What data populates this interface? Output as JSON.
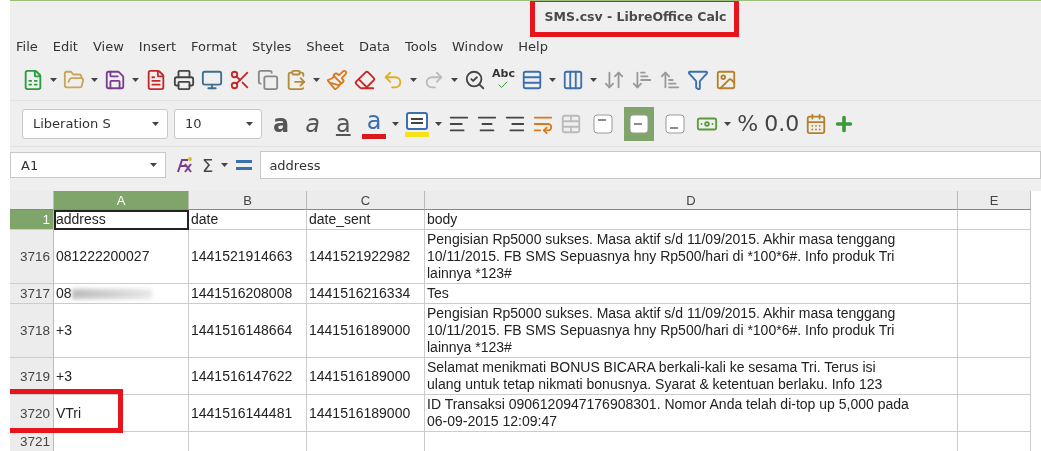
{
  "window": {
    "title": "SMS.csv - LibreOffice Calc",
    "title_highlighted": true
  },
  "menu": [
    "File",
    "Edit",
    "View",
    "Insert",
    "Format",
    "Styles",
    "Sheet",
    "Data",
    "Tools",
    "Window",
    "Help"
  ],
  "standard_toolbar": {
    "spelling_label": "Abc"
  },
  "format_toolbar": {
    "font_name": "Liberation S",
    "font_size": "10",
    "style_buttons": [
      {
        "kind": "bold",
        "label": "a"
      },
      {
        "kind": "italic",
        "label": "a"
      },
      {
        "kind": "underline",
        "label": "a"
      },
      {
        "kind": "font_color",
        "label": "a"
      }
    ],
    "vertical_align": [
      {
        "selected": false
      },
      {
        "selected": true
      },
      {
        "selected": false
      }
    ],
    "percent": "%",
    "number_format": "0.0"
  },
  "formula_bar": {
    "cell_ref": "A1",
    "sum": "Σ",
    "value": "address"
  },
  "columns": [
    {
      "label": "A",
      "selected": true
    },
    {
      "label": "B",
      "selected": false
    },
    {
      "label": "C",
      "selected": false
    },
    {
      "label": "D",
      "selected": false
    },
    {
      "label": "E",
      "selected": false
    }
  ],
  "rows": [
    {
      "number": "1",
      "selected": true,
      "highlighted": false,
      "address": "address",
      "redacted": false,
      "date": "date",
      "date_sent": "date_sent",
      "body": [
        "body"
      ]
    },
    {
      "number": "3716",
      "selected": false,
      "highlighted": false,
      "address": "081222200027",
      "redacted": false,
      "date": "1441521914663",
      "date_sent": "1441521922982",
      "body": [
        "Pengisian Rp5000 sukses. Masa aktif s/d 11/09/2015. Akhir masa tenggang",
        "10/11/2015. FB SMS Sepuasnya hny Rp500/hari di *100*6#. Info produk Tri",
        "lainnya *123#"
      ]
    },
    {
      "number": "3717",
      "selected": false,
      "highlighted": false,
      "address": "08",
      "redacted": true,
      "date": "1441516208008",
      "date_sent": "1441516216334",
      "body": [
        "Tes"
      ]
    },
    {
      "number": "3718",
      "selected": false,
      "highlighted": false,
      "address": "+3",
      "redacted": false,
      "date": "1441516148664",
      "date_sent": "1441516189000",
      "body": [
        "Pengisian Rp5000 sukses. Masa aktif s/d 11/09/2015. Akhir masa tenggang",
        "10/11/2015. FB SMS Sepuasnya hny Rp500/hari di *100*6#. Info produk Tri",
        "lainnya *123#"
      ]
    },
    {
      "number": "3719",
      "selected": false,
      "highlighted": false,
      "address": "+3",
      "redacted": false,
      "date": "1441516147622",
      "date_sent": "1441516189000",
      "body": [
        "Selamat menikmati BONUS BICARA berkali-kali ke sesama Tri. Terus isi",
        "ulang untuk tetap nikmati bonusnya. Syarat & ketentuan berlaku. Info 123"
      ]
    },
    {
      "number": "3720",
      "selected": false,
      "highlighted": true,
      "address": "VTri",
      "redacted": false,
      "date": "1441516144481",
      "date_sent": "1441516189000",
      "body": [
        "ID Transaksi 0906120947176908301. Nomor Anda telah di-top up 5,000 pada",
        "06-09-2015 12:09:47"
      ]
    },
    {
      "number": "3721",
      "selected": false,
      "highlighted": false,
      "address": "",
      "redacted": false,
      "date": "",
      "date_sent": "",
      "body": []
    }
  ]
}
